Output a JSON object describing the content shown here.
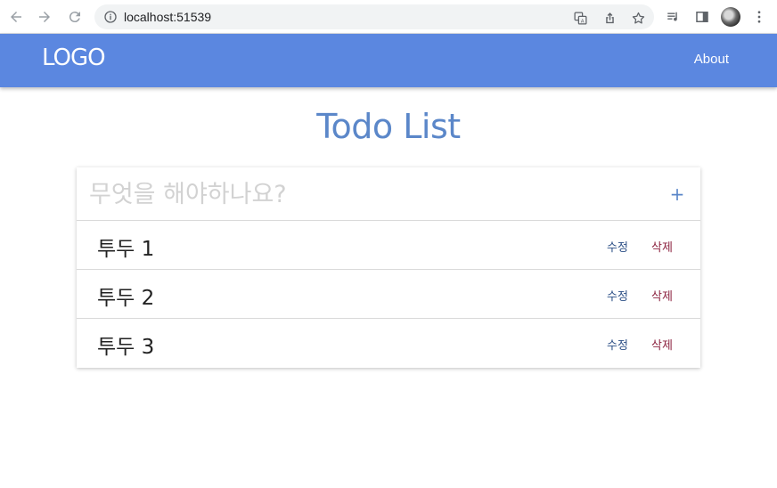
{
  "browser": {
    "url": "localhost:51539"
  },
  "header": {
    "logo": "LOGO",
    "about_label": "About",
    "bg_color": "#5b87e0"
  },
  "main": {
    "title": "Todo List",
    "input_placeholder": "무엇을 해야하나요?",
    "add_label": "+"
  },
  "todos": [
    {
      "text": "투두 1",
      "edit_label": "수정",
      "delete_label": "삭제"
    },
    {
      "text": "투두 2",
      "edit_label": "수정",
      "delete_label": "삭제"
    },
    {
      "text": "투두 3",
      "edit_label": "수정",
      "delete_label": "삭제"
    }
  ],
  "colors": {
    "accent": "#5b87c9",
    "edit": "#2c4f86",
    "delete": "#8c2340"
  },
  "icons": [
    "back-arrow-icon",
    "forward-arrow-icon",
    "reload-icon",
    "info-icon",
    "translate-icon",
    "share-icon",
    "star-icon",
    "media-icon",
    "side-panel-icon",
    "more-vert-icon"
  ]
}
